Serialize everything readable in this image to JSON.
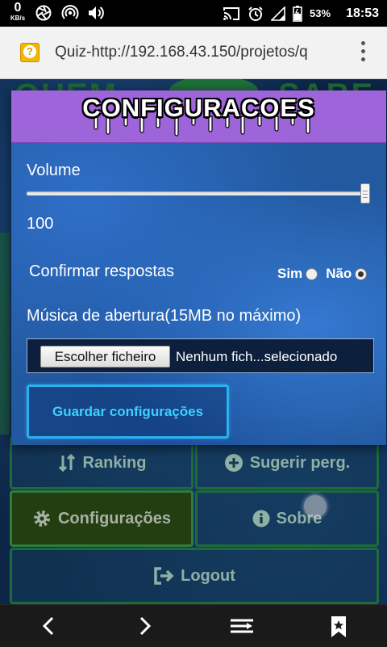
{
  "status_bar": {
    "net_speed_value": "0",
    "net_speed_unit": "KB/s",
    "battery_percent": "53%",
    "time": "18:53",
    "icons": [
      "aperture-icon",
      "hotspot-icon",
      "volume-icon",
      "cast-icon",
      "alarm-icon",
      "signal-icon",
      "battery-icon"
    ]
  },
  "browser": {
    "page_title": "Quiz-http://192.168.43.150/projetos/q",
    "favicon": "question-favicon",
    "menu_icon": "overflow-menu-icon"
  },
  "background_menu": {
    "ranking_label": "Ranking",
    "suggest_label": "Sugerir perg.",
    "settings_label": "Configurações",
    "about_label": "Sobre",
    "logout_label": "Logout",
    "header_left": "QUEM",
    "header_right": "SABE"
  },
  "modal": {
    "title": "CONFIGURACOES",
    "volume_label": "Volume",
    "volume_value": "100",
    "volume_level": 1.0,
    "confirm_label": "Confirmar respostas",
    "confirm_options": [
      "Sim",
      "Não"
    ],
    "confirm_selected": "Não",
    "music_label": "Música de abertura(15MB no máximo)",
    "file_button_label": "Escolher ficheiro",
    "file_status": "Nenhum fich...selecionado",
    "save_label": "Guardar configurações"
  },
  "colors": {
    "modal_header": "#9e64da",
    "modal_body": "#22599f",
    "save_accent": "#29b1f0",
    "menu_border": "#1e6b3a"
  },
  "nav_bar": {
    "icons": [
      "back-icon",
      "forward-icon",
      "tabs-icon",
      "bookmark-icon"
    ]
  }
}
